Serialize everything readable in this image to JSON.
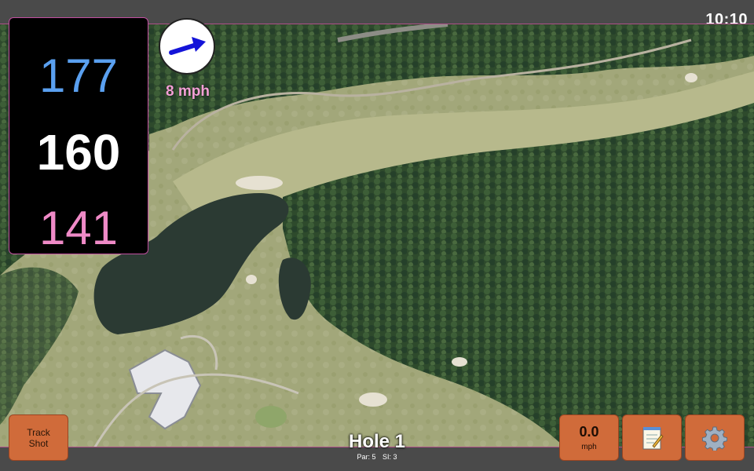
{
  "status": {
    "clock": "10:10"
  },
  "distances": {
    "back": "177",
    "middle": "160",
    "front": "141"
  },
  "wind": {
    "speed": "8 mph",
    "arrow_icon": "wind-direction-arrow-icon"
  },
  "hole": {
    "title": "Hole 1",
    "par": "Par: 5",
    "stroke_index": "SI: 3"
  },
  "buttons": {
    "track_shot_line1": "Track",
    "track_shot_line2": "Shot",
    "speed_value": "0.0",
    "speed_unit": "mph",
    "notes_icon": "notepad-icon",
    "settings_icon": "gear-icon"
  },
  "colors": {
    "back_distance": "#5aa0f0",
    "middle_distance": "#ffffff",
    "front_distance": "#ef8ac7",
    "button_bg": "#d06b3a",
    "accent_border": "#c24fa0"
  }
}
